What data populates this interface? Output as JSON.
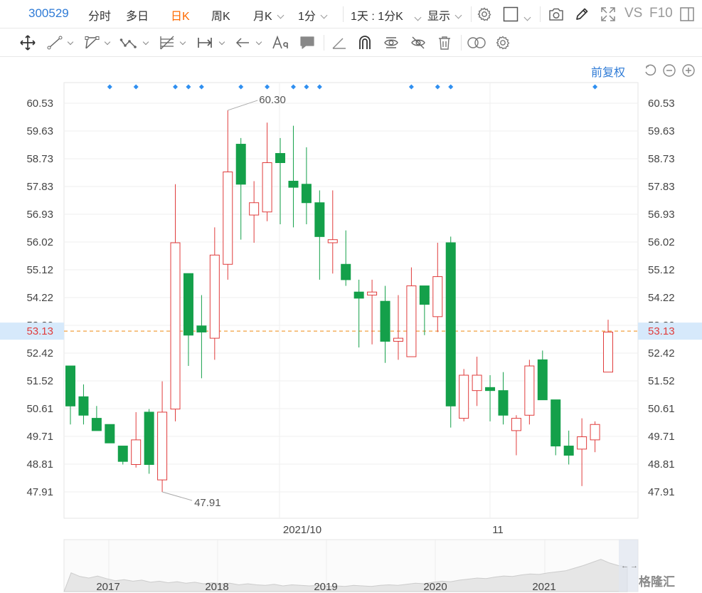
{
  "toolbar": {
    "stock_code": "300529",
    "tabs": [
      {
        "label": "分时",
        "active": false
      },
      {
        "label": "多日",
        "active": false
      },
      {
        "label": "日K",
        "active": true
      },
      {
        "label": "周K",
        "active": false
      },
      {
        "label": "月K",
        "active": false
      }
    ],
    "minute_select": "1分",
    "period_select": "1天 : 1分K",
    "display_select": "显示",
    "vs_label": "VS",
    "f10_label": "F10"
  },
  "drawing_tools": [
    "move-icon",
    "line-icon",
    "polyline-icon",
    "wave-icon",
    "fib-icon",
    "range-icon",
    "arrow-icon",
    "text-tool-icon",
    "comment-icon",
    "angle-icon",
    "magnet-icon",
    "eye-sync-icon",
    "eye-off-icon",
    "trash-icon",
    "compare-icon",
    "settings-icon"
  ],
  "chart_controls": {
    "adjust_label": "前复权"
  },
  "colors": {
    "up": "#e03c3c",
    "down": "#14a04a",
    "accent": "#2f7bd6",
    "active_tab": "#ff6a00",
    "current_line": "#f0a040",
    "current_bg": "#d6e9fb"
  },
  "chart_data": {
    "type": "candlestick",
    "y_ticks": [
      "60.53",
      "59.63",
      "58.73",
      "57.83",
      "56.93",
      "56.02",
      "55.12",
      "54.22",
      "53.32",
      "52.42",
      "51.52",
      "50.61",
      "49.71",
      "48.81",
      "47.91"
    ],
    "ylim": [
      47.91,
      60.53
    ],
    "current_price": "53.13",
    "high_label": "60.30",
    "low_label": "47.91",
    "x_labels": [
      "2021/10",
      "11"
    ],
    "candles": [
      {
        "o": 50.7,
        "c": 52.0,
        "h": 52.0,
        "l": 50.1,
        "dir": "down"
      },
      {
        "o": 50.4,
        "c": 51.0,
        "h": 51.4,
        "l": 50.1,
        "dir": "down"
      },
      {
        "o": 49.9,
        "c": 50.3,
        "h": 50.7,
        "l": 49.9,
        "dir": "down"
      },
      {
        "o": 49.5,
        "c": 50.1,
        "h": 50.1,
        "l": 49.5,
        "dir": "down"
      },
      {
        "o": 48.9,
        "c": 49.4,
        "h": 49.4,
        "l": 48.8,
        "dir": "down"
      },
      {
        "o": 48.8,
        "c": 49.6,
        "h": 50.5,
        "l": 48.7,
        "dir": "up"
      },
      {
        "o": 48.8,
        "c": 50.5,
        "h": 50.6,
        "l": 48.5,
        "dir": "down"
      },
      {
        "o": 48.3,
        "c": 50.5,
        "h": 51.5,
        "l": 47.91,
        "dir": "up"
      },
      {
        "o": 50.6,
        "c": 56.0,
        "h": 57.9,
        "l": 50.2,
        "dir": "up"
      },
      {
        "o": 53.0,
        "c": 55.0,
        "h": 55.0,
        "l": 52.0,
        "dir": "down"
      },
      {
        "o": 53.1,
        "c": 53.3,
        "h": 54.3,
        "l": 51.6,
        "dir": "down"
      },
      {
        "o": 52.9,
        "c": 55.6,
        "h": 56.5,
        "l": 52.2,
        "dir": "up"
      },
      {
        "o": 55.3,
        "c": 58.3,
        "h": 60.3,
        "l": 54.8,
        "dir": "up"
      },
      {
        "o": 57.9,
        "c": 59.2,
        "h": 59.4,
        "l": 56.1,
        "dir": "down"
      },
      {
        "o": 56.9,
        "c": 57.3,
        "h": 58.0,
        "l": 56.0,
        "dir": "up"
      },
      {
        "o": 57.0,
        "c": 58.6,
        "h": 59.9,
        "l": 56.7,
        "dir": "up"
      },
      {
        "o": 58.6,
        "c": 58.9,
        "h": 59.4,
        "l": 56.6,
        "dir": "down"
      },
      {
        "o": 57.8,
        "c": 58.0,
        "h": 59.8,
        "l": 56.5,
        "dir": "down"
      },
      {
        "o": 57.3,
        "c": 57.9,
        "h": 59.1,
        "l": 56.6,
        "dir": "down"
      },
      {
        "o": 56.2,
        "c": 57.3,
        "h": 57.7,
        "l": 54.8,
        "dir": "down"
      },
      {
        "o": 56.0,
        "c": 56.1,
        "h": 57.7,
        "l": 55.0,
        "dir": "up"
      },
      {
        "o": 54.8,
        "c": 55.3,
        "h": 56.4,
        "l": 54.6,
        "dir": "down"
      },
      {
        "o": 54.2,
        "c": 54.4,
        "h": 54.8,
        "l": 52.6,
        "dir": "down"
      },
      {
        "o": 54.3,
        "c": 54.4,
        "h": 54.8,
        "l": 52.7,
        "dir": "up"
      },
      {
        "o": 52.8,
        "c": 54.1,
        "h": 54.6,
        "l": 52.1,
        "dir": "down"
      },
      {
        "o": 52.8,
        "c": 52.9,
        "h": 54.3,
        "l": 52.2,
        "dir": "up"
      },
      {
        "o": 52.3,
        "c": 54.6,
        "h": 55.2,
        "l": 52.3,
        "dir": "up"
      },
      {
        "o": 54.0,
        "c": 54.6,
        "h": 54.6,
        "l": 53.0,
        "dir": "down"
      },
      {
        "o": 53.6,
        "c": 54.9,
        "h": 56.0,
        "l": 53.1,
        "dir": "up"
      },
      {
        "o": 50.7,
        "c": 56.0,
        "h": 56.2,
        "l": 50.0,
        "dir": "down"
      },
      {
        "o": 50.3,
        "c": 51.7,
        "h": 51.9,
        "l": 50.2,
        "dir": "up"
      },
      {
        "o": 51.2,
        "c": 51.7,
        "h": 52.3,
        "l": 50.7,
        "dir": "up"
      },
      {
        "o": 51.2,
        "c": 51.3,
        "h": 51.7,
        "l": 50.2,
        "dir": "down"
      },
      {
        "o": 50.4,
        "c": 51.2,
        "h": 51.8,
        "l": 50.1,
        "dir": "down"
      },
      {
        "o": 49.9,
        "c": 50.3,
        "h": 50.4,
        "l": 49.1,
        "dir": "up"
      },
      {
        "o": 50.4,
        "c": 52.0,
        "h": 52.2,
        "l": 50.1,
        "dir": "up"
      },
      {
        "o": 50.9,
        "c": 52.2,
        "h": 52.5,
        "l": 50.9,
        "dir": "down"
      },
      {
        "o": 49.4,
        "c": 50.9,
        "h": 50.9,
        "l": 49.1,
        "dir": "down"
      },
      {
        "o": 49.1,
        "c": 49.4,
        "h": 49.9,
        "l": 48.8,
        "dir": "down"
      },
      {
        "o": 49.3,
        "c": 49.7,
        "h": 50.3,
        "l": 48.1,
        "dir": "up"
      },
      {
        "o": 49.6,
        "c": 50.1,
        "h": 50.2,
        "l": 49.2,
        "dir": "up"
      },
      {
        "o": 51.8,
        "c": 53.1,
        "h": 53.5,
        "l": 51.8,
        "dir": "up"
      }
    ],
    "marker_indices": [
      3,
      5,
      8,
      9,
      10,
      13,
      15,
      17,
      18,
      19,
      26,
      28,
      29,
      40
    ],
    "navigator_year_labels": [
      "2017",
      "2018",
      "2019",
      "2020",
      "2021"
    ],
    "navigator_profile": [
      0.36,
      0.29,
      0.26,
      0.3,
      0.25,
      0.21,
      0.23,
      0.2,
      0.22,
      0.18,
      0.2,
      0.17,
      0.19,
      0.16,
      0.18,
      0.15,
      0.17,
      0.15,
      0.16,
      0.13,
      0.15,
      0.13,
      0.12,
      0.14,
      0.11,
      0.13,
      0.12,
      0.11,
      0.12,
      0.1,
      0.11,
      0.1,
      0.12,
      0.11,
      0.1,
      0.12,
      0.13,
      0.12,
      0.14,
      0.16,
      0.15,
      0.18,
      0.2,
      0.19,
      0.22,
      0.24,
      0.26,
      0.25,
      0.28,
      0.3,
      0.29,
      0.32,
      0.34,
      0.33,
      0.36,
      0.38,
      0.4,
      0.45,
      0.5,
      0.56,
      0.62,
      0.55,
      0.5,
      0.48
    ],
    "navigator_arrows": [
      "←",
      "→"
    ]
  },
  "watermark": "格隆汇"
}
